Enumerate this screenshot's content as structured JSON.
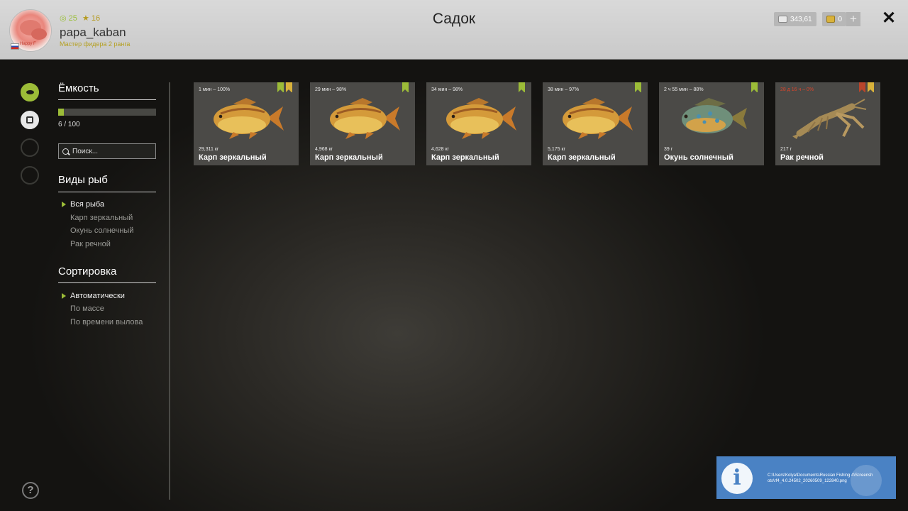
{
  "header": {
    "title": "Садок",
    "username": "papa_kaban",
    "rank": "Мастер фидера 2 ранга",
    "level": "25",
    "stars": "16",
    "avatar_text": "Happy F",
    "silver": "343,61",
    "gold": "0",
    "add_symbol": "+",
    "close_symbol": "✕"
  },
  "capacity": {
    "title": "Ёмкость",
    "text": "6 / 100",
    "fill_fraction": 0.06
  },
  "search": {
    "placeholder": "Поиск..."
  },
  "species": {
    "title": "Виды рыб",
    "items": [
      {
        "label": "Вся рыба",
        "active": true
      },
      {
        "label": "Карп зеркальный",
        "active": false
      },
      {
        "label": "Окунь солнечный",
        "active": false
      },
      {
        "label": "Рак речной",
        "active": false
      }
    ]
  },
  "sort": {
    "title": "Сортировка",
    "items": [
      {
        "label": "Автоматически",
        "active": true
      },
      {
        "label": "По массе",
        "active": false
      },
      {
        "label": "По времени вылова",
        "active": false
      }
    ]
  },
  "fish": [
    {
      "time": "1 мин – 100%",
      "weight": "29,311 кг",
      "name": "Карп зеркальный",
      "badges": [
        "green",
        "yellow"
      ],
      "kind": "carp"
    },
    {
      "time": "29 мин – 98%",
      "weight": "4,968 кг",
      "name": "Карп зеркальный",
      "badges": [
        "green"
      ],
      "kind": "carp"
    },
    {
      "time": "34 мин – 98%",
      "weight": "4,628 кг",
      "name": "Карп зеркальный",
      "badges": [
        "green"
      ],
      "kind": "carp"
    },
    {
      "time": "38 мин – 97%",
      "weight": "5,175 кг",
      "name": "Карп зеркальный",
      "badges": [
        "green"
      ],
      "kind": "carp"
    },
    {
      "time": "2 ч 55 мин – 88%",
      "weight": "39 г",
      "name": "Окунь солнечный",
      "badges": [
        "green"
      ],
      "kind": "sunfish"
    },
    {
      "time": "28 д 16 ч – 0%",
      "weight": "217 г",
      "name": "Рак речной",
      "badges": [
        "red",
        "yellow"
      ],
      "kind": "crayfish",
      "expired": true
    }
  ],
  "help": {
    "symbol": "?"
  },
  "notification": {
    "icon": "i",
    "path": "C:\\Users\\Kolya\\Documents\\Russian Fishing 4\\Screenshots\\rf4_4.0.24502_20260509_122840.png"
  },
  "colors": {
    "accent": "#9cbc38",
    "gold": "#d9b23b",
    "expired": "#d9452b",
    "notification": "#4a82c4"
  }
}
